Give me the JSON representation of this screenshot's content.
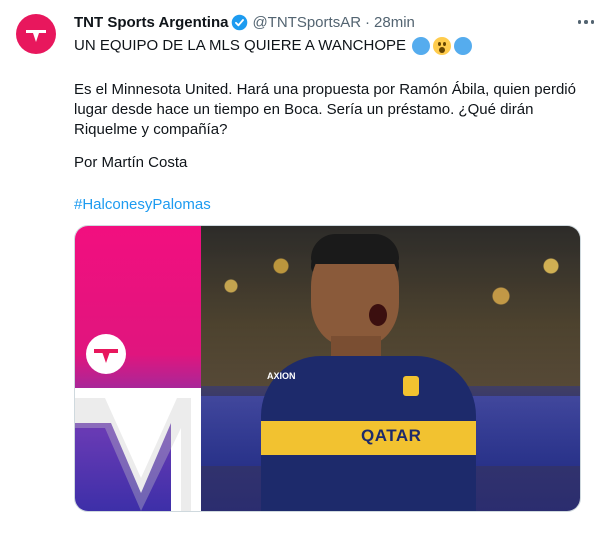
{
  "tweet": {
    "author_name": "TNT Sports Argentina",
    "handle": "@TNTSportsAR",
    "separator": "·",
    "timestamp": "28min",
    "headline": "UN EQUIPO DE LA MLS QUIERE A WANCHOPE",
    "body": "Es el Minnesota United. Hará una propuesta por Ramón Ábila, quien perdió lugar desde hace un tiempo en Boca. Sería un préstamo. ¿Qué dirán Riquelme y compañía?",
    "byline": "Por Martín Costa",
    "hashtag": "#HalconesyPalomas"
  },
  "media": {
    "jersey_sponsor": "QATAR",
    "sleeve_sponsor": "AXION"
  },
  "icons": {
    "avatar": "tnt-sports-logo",
    "verified": "verified-badge-icon",
    "more": "more-options-icon",
    "emoji": [
      "blue-circle-icon",
      "astonished-face-icon",
      "blue-circle-icon"
    ]
  },
  "colors": {
    "accent": "#1d9bf0",
    "brand": "#e8175d",
    "text": "#0f1419",
    "muted": "#536471"
  }
}
